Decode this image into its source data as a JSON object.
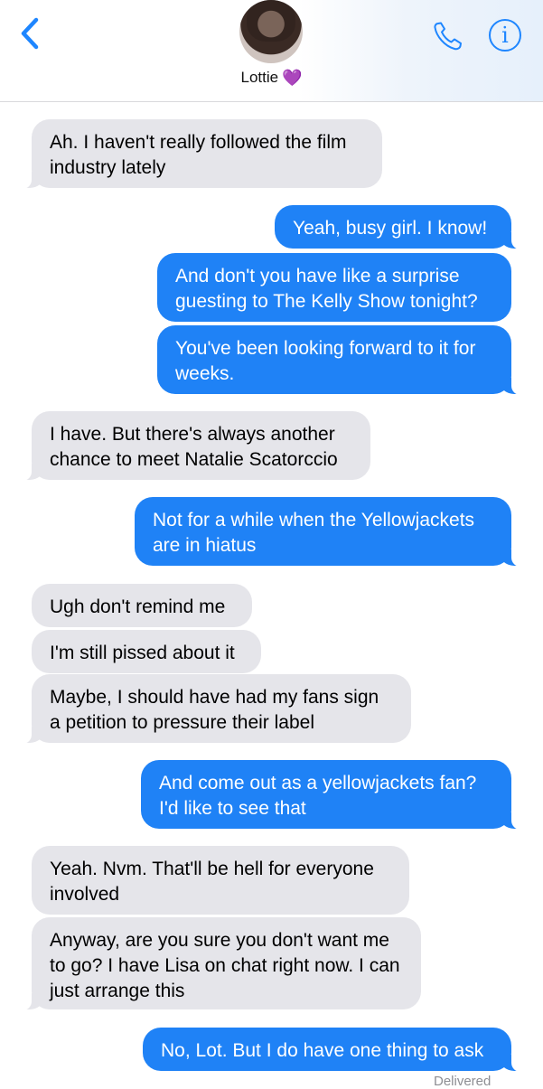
{
  "header": {
    "contact_name": "Lottie",
    "heart_emoji": "💜",
    "accent_color": "#1e86ff",
    "icons": {
      "back": "chevron-left-icon",
      "call": "phone-icon",
      "info": "info-icon"
    },
    "info_glyph": "i"
  },
  "messages": [
    {
      "from": "them",
      "text": "Ah. I haven't really followed the film industry lately"
    },
    {
      "from": "me",
      "text": "Yeah, busy girl. I know!"
    },
    {
      "from": "me",
      "text": "And don't you have like a surprise guesting to The Kelly Show tonight?"
    },
    {
      "from": "me",
      "text": "You've been looking forward to it for weeks."
    },
    {
      "from": "them",
      "text": "I have. But there's always another chance to meet Natalie Scatorccio"
    },
    {
      "from": "me",
      "text": "Not for a while when the Yellowjackets are in hiatus"
    },
    {
      "from": "them",
      "text": "Ugh don't remind me"
    },
    {
      "from": "them",
      "text": "I'm still pissed about it"
    },
    {
      "from": "them",
      "text": "Maybe, I should have had my fans sign a petition to pressure their label"
    },
    {
      "from": "me",
      "text": "And come out as a yellowjackets fan? I'd like to see that"
    },
    {
      "from": "them",
      "text": "Yeah. Nvm. That'll be hell for everyone involved"
    },
    {
      "from": "them",
      "text": "Anyway, are you sure you don't want me to go? I have Lisa on chat right now. I can just arrange this"
    },
    {
      "from": "me",
      "text": "No, Lot. But I do have one thing to ask"
    }
  ],
  "status": {
    "delivered": "Delivered"
  },
  "colors": {
    "incoming": "#e5e5ea",
    "outgoing": "#1f82f6"
  }
}
